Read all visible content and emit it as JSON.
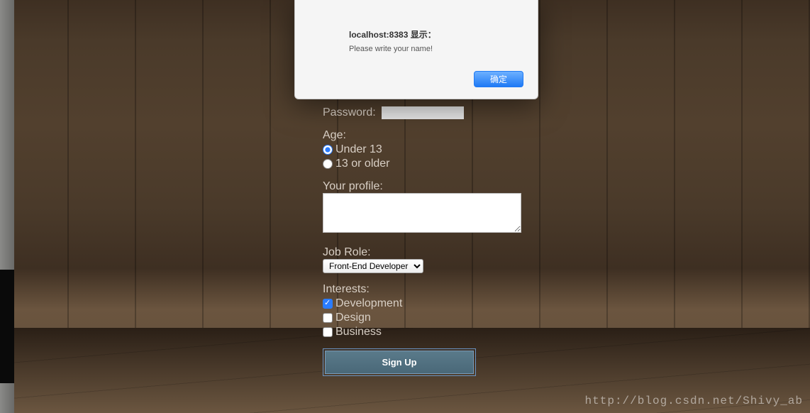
{
  "dialog": {
    "title": "localhost:8383 显示：",
    "message": "Please write your name!",
    "ok_label": "确定"
  },
  "form": {
    "password_label": "Password:",
    "age_label": "Age:",
    "age_options": {
      "under13": "Under 13",
      "over13": "13 or older"
    },
    "profile_label": "Your profile:",
    "job_label": "Job Role:",
    "job_selected": "Front-End Developer",
    "interests_label": "Interests:",
    "interests": {
      "development": "Development",
      "design": "Design",
      "business": "Business"
    },
    "signup_label": "Sign Up"
  },
  "watermark": "http://blog.csdn.net/Shivy_ab"
}
